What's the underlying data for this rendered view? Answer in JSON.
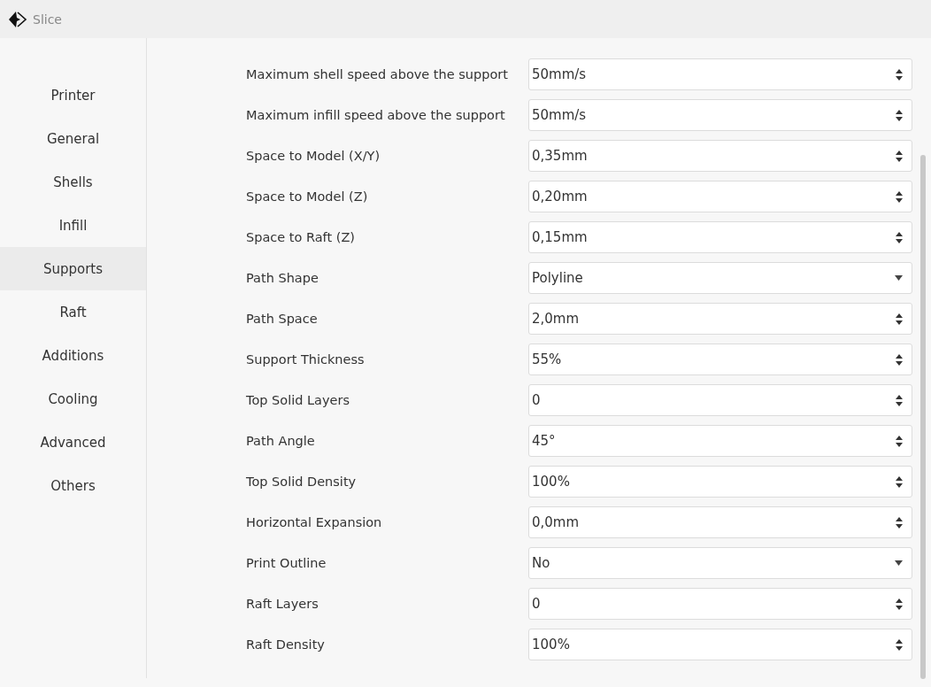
{
  "window": {
    "title": "Slice"
  },
  "sidebar": {
    "items": [
      {
        "label": "Printer",
        "selected": false
      },
      {
        "label": "General",
        "selected": false
      },
      {
        "label": "Shells",
        "selected": false
      },
      {
        "label": "Infill",
        "selected": false
      },
      {
        "label": "Supports",
        "selected": true
      },
      {
        "label": "Raft",
        "selected": false
      },
      {
        "label": "Additions",
        "selected": false
      },
      {
        "label": "Cooling",
        "selected": false
      },
      {
        "label": "Advanced",
        "selected": false
      },
      {
        "label": "Others",
        "selected": false
      }
    ]
  },
  "settings": [
    {
      "label": "Maximum shell speed above the support",
      "kind": "spin",
      "value": "50mm/s"
    },
    {
      "label": "Maximum infill speed above the support",
      "kind": "spin",
      "value": "50mm/s"
    },
    {
      "label": "Space to Model (X/Y)",
      "kind": "spin",
      "value": "0,35mm"
    },
    {
      "label": "Space to Model (Z)",
      "kind": "spin",
      "value": "0,20mm"
    },
    {
      "label": "Space to Raft (Z)",
      "kind": "spin",
      "value": "0,15mm"
    },
    {
      "label": "Path Shape",
      "kind": "dropdown",
      "value": "Polyline"
    },
    {
      "label": "Path Space",
      "kind": "spin",
      "value": "2,0mm"
    },
    {
      "label": "Support Thickness",
      "kind": "spin",
      "value": "55%"
    },
    {
      "label": "Top Solid Layers",
      "kind": "spin",
      "value": "0"
    },
    {
      "label": "Path Angle",
      "kind": "spin",
      "value": "45°"
    },
    {
      "label": "Top Solid Density",
      "kind": "spin",
      "value": "100%"
    },
    {
      "label": "Horizontal Expansion",
      "kind": "spin",
      "value": "0,0mm"
    },
    {
      "label": "Print Outline",
      "kind": "dropdown",
      "value": "No"
    },
    {
      "label": "Raft Layers",
      "kind": "spin",
      "value": "0"
    },
    {
      "label": "Raft Density",
      "kind": "spin",
      "value": "100%"
    }
  ]
}
